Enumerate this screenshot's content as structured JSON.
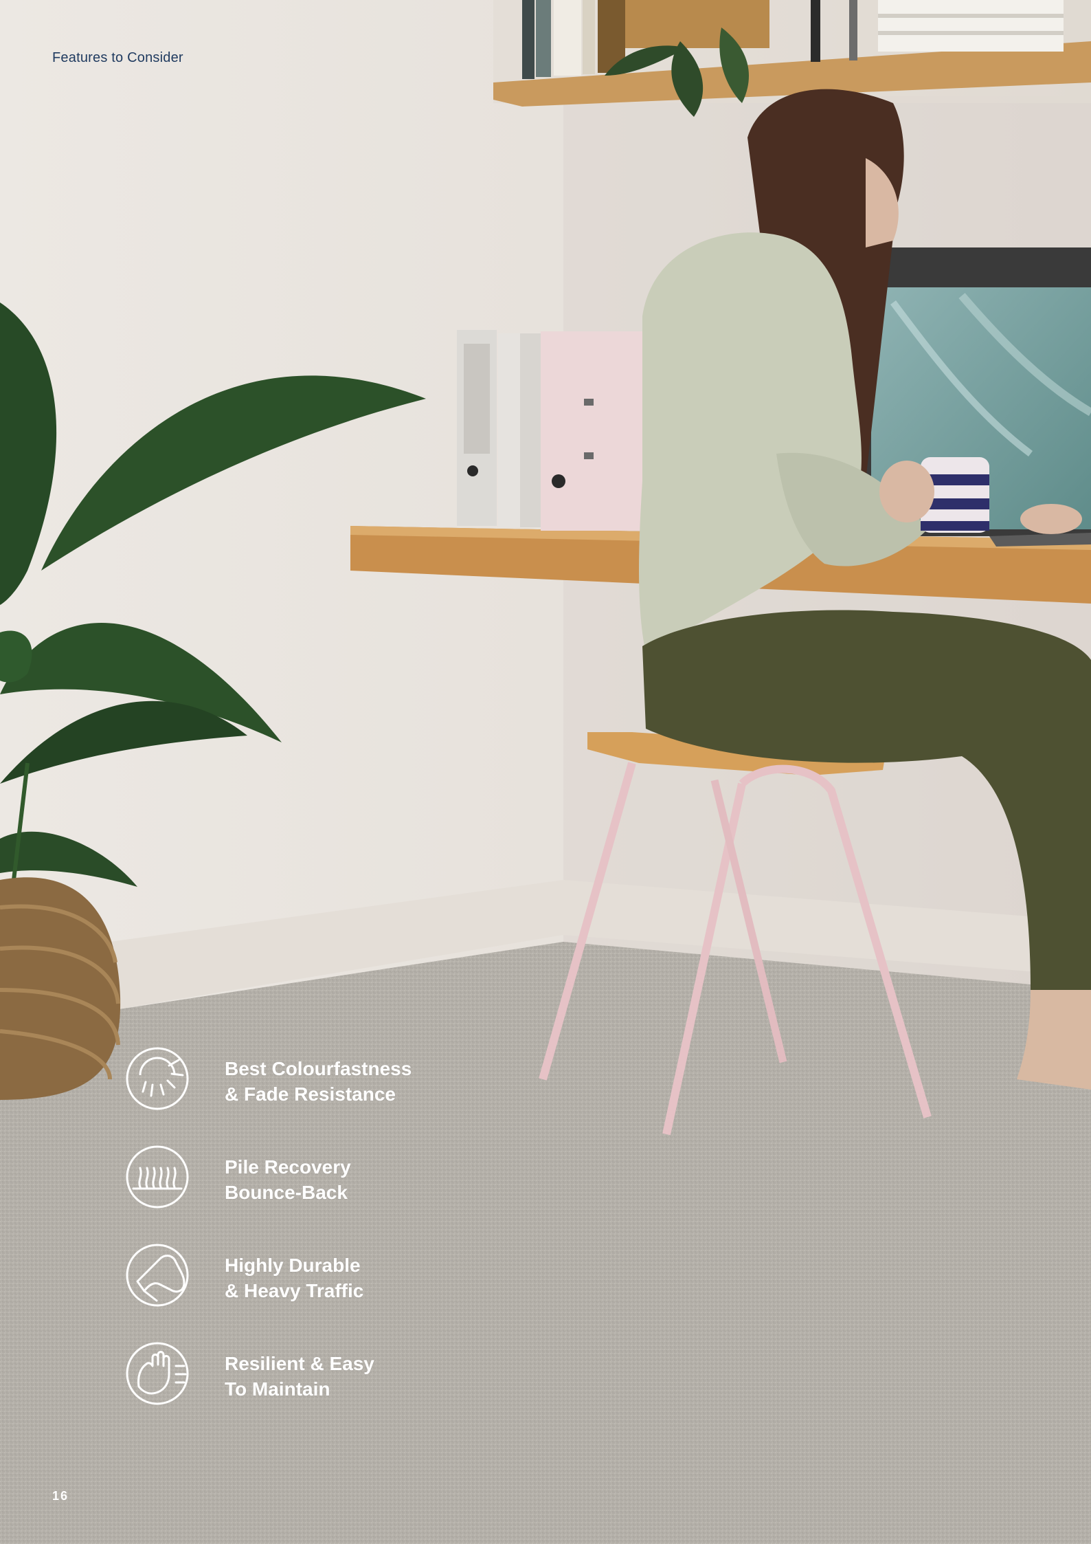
{
  "header": {
    "section_label": "Features to Consider"
  },
  "features": [
    {
      "icon": "sun-fade-icon",
      "line1": "Best Colourfastness",
      "line2": "& Fade Resistance"
    },
    {
      "icon": "carpet-pile-icon",
      "line1": "Pile Recovery",
      "line2": "Bounce-Back"
    },
    {
      "icon": "footstep-traffic-icon",
      "line1": "Highly Durable",
      "line2": "& Heavy Traffic"
    },
    {
      "icon": "hand-clean-icon",
      "line1": "Resilient & Easy",
      "line2": "To Maintain"
    }
  ],
  "footer": {
    "page_number": "16"
  },
  "colors": {
    "accent_text": "#1f3a5f",
    "overlay_text": "#ffffff",
    "carpet": "#b5b2ab",
    "wall": "#e9e4de"
  }
}
